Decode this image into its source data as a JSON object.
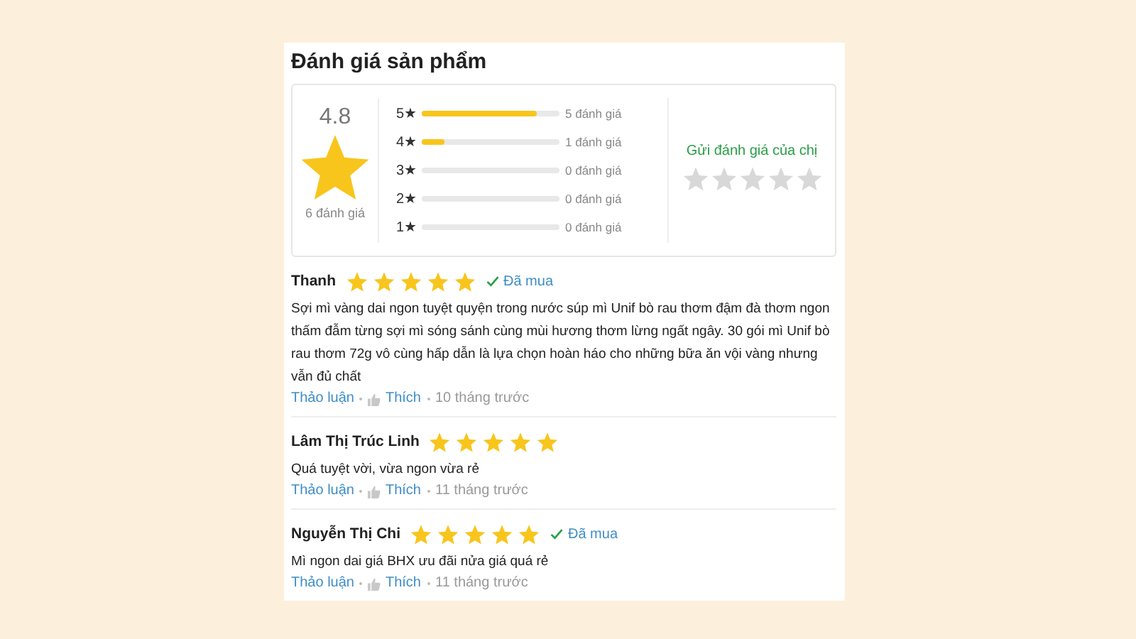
{
  "title": "Đánh giá sản phẩm",
  "summary": {
    "average": "4.8",
    "total": "6 đánh giá",
    "bars": [
      {
        "label": "5★",
        "level": 0.83,
        "count": "5 đánh giá"
      },
      {
        "label": "4★",
        "level": 0.17,
        "count": "1 đánh giá"
      },
      {
        "label": "3★",
        "level": 0,
        "count": "0 đánh giá"
      },
      {
        "label": "2★",
        "level": 0,
        "count": "0 đánh giá"
      },
      {
        "label": "1★",
        "level": 0,
        "count": "0 đánh giá"
      }
    ],
    "rate": {
      "prompt": "Gửi đánh giá của chị",
      "stars": 0
    }
  },
  "reviews": [
    {
      "name": "Thanh",
      "stars": 5,
      "verified": true,
      "verified_label": "Đã mua",
      "text": "Sợi mì vàng dai ngon tuyệt quyện trong nước súp mì Unif bò rau thơm đậm đà thơm ngon thấm đẫm từng sợi mì sóng sánh cùng mùi hương thơm lừng ngất ngây. 30 gói mì Unif bò rau thơm 72g vô cùng hấp dẫn là lựa chọn hoàn háo cho những bữa ăn vội vàng nhưng vẫn đủ chất",
      "discuss": "Thảo luận",
      "like": "Thích",
      "time": "10 tháng trước"
    },
    {
      "name": "Lâm Thị Trúc Linh",
      "stars": 5,
      "verified": false,
      "text": "Quá tuyệt vời, vừa ngon vừa rẻ",
      "discuss": "Thảo luận",
      "like": "Thích",
      "time": "11 tháng trước"
    },
    {
      "name": "Nguyễn Thị Chi",
      "stars": 5,
      "verified": true,
      "verified_label": "Đã mua",
      "text": "Mì ngon dai giá BHX ưu đãi nửa giá quá rẻ",
      "discuss": "Thảo luận",
      "like": "Thích",
      "time": "11 tháng trước"
    }
  ]
}
